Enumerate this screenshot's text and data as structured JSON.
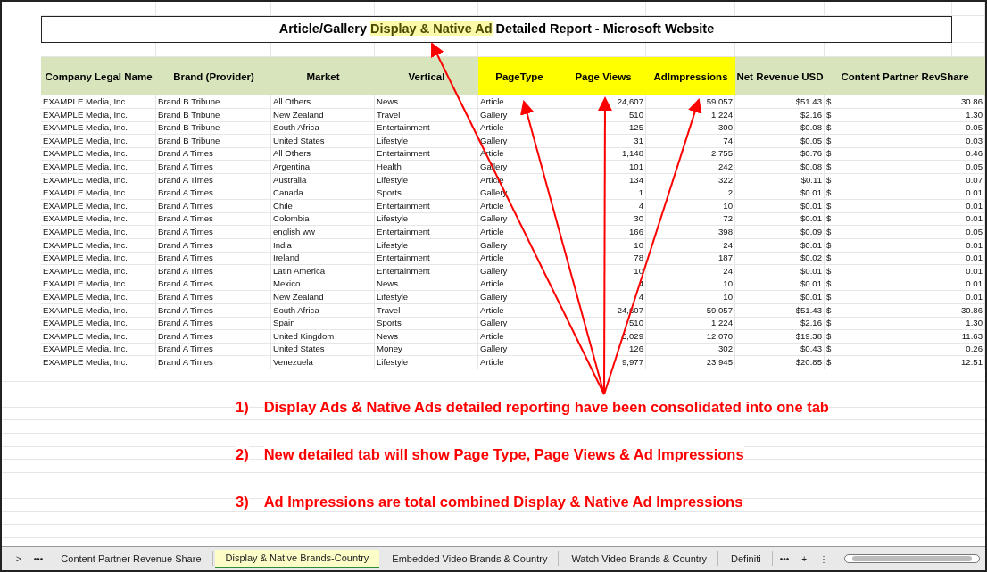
{
  "title": {
    "before": "Article/Gallery ",
    "highlight": "Display & Native Ad",
    "after": " Detailed Report - Microsoft Website"
  },
  "columns": [
    {
      "label": "Company Legal Name",
      "highlighted": false
    },
    {
      "label": "Brand (Provider)",
      "highlighted": false
    },
    {
      "label": "Market",
      "highlighted": false
    },
    {
      "label": "Vertical",
      "highlighted": false
    },
    {
      "label": "PageType",
      "highlighted": true
    },
    {
      "label": "Page Views",
      "highlighted": true
    },
    {
      "label": "AdImpressions",
      "highlighted": true
    },
    {
      "label": "Net Revenue USD",
      "highlighted": false
    },
    {
      "label": "Content Partner RevShare",
      "highlighted": false
    }
  ],
  "rows": [
    [
      "EXAMPLE Media, Inc.",
      "Brand B Tribune",
      "All Others",
      "News",
      "Article",
      "24,607",
      "59,057",
      "$51.43",
      "$",
      "30.86"
    ],
    [
      "EXAMPLE Media, Inc.",
      "Brand B Tribune",
      "New Zealand",
      "Travel",
      "Gallery",
      "510",
      "1,224",
      "$2.16",
      "$",
      "1.30"
    ],
    [
      "EXAMPLE Media, Inc.",
      "Brand B Tribune",
      "South Africa",
      "Entertainment",
      "Article",
      "125",
      "300",
      "$0.08",
      "$",
      "0.05"
    ],
    [
      "EXAMPLE Media, Inc.",
      "Brand B Tribune",
      "United States",
      "Lifestyle",
      "Gallery",
      "31",
      "74",
      "$0.05",
      "$",
      "0.03"
    ],
    [
      "EXAMPLE Media, Inc.",
      "Brand A Times",
      "All Others",
      "Entertainment",
      "Article",
      "1,148",
      "2,755",
      "$0.76",
      "$",
      "0.46"
    ],
    [
      "EXAMPLE Media, Inc.",
      "Brand A Times",
      "Argentina",
      "Health",
      "Gallery",
      "101",
      "242",
      "$0.08",
      "$",
      "0.05"
    ],
    [
      "EXAMPLE Media, Inc.",
      "Brand A Times",
      "Australia",
      "Lifestyle",
      "Article",
      "134",
      "322",
      "$0.11",
      "$",
      "0.07"
    ],
    [
      "EXAMPLE Media, Inc.",
      "Brand A Times",
      "Canada",
      "Sports",
      "Gallery",
      "1",
      "2",
      "$0.01",
      "$",
      "0.01"
    ],
    [
      "EXAMPLE Media, Inc.",
      "Brand A Times",
      "Chile",
      "Entertainment",
      "Article",
      "4",
      "10",
      "$0.01",
      "$",
      "0.01"
    ],
    [
      "EXAMPLE Media, Inc.",
      "Brand A Times",
      "Colombia",
      "Lifestyle",
      "Gallery",
      "30",
      "72",
      "$0.01",
      "$",
      "0.01"
    ],
    [
      "EXAMPLE Media, Inc.",
      "Brand A Times",
      "english ww",
      "Entertainment",
      "Article",
      "166",
      "398",
      "$0.09",
      "$",
      "0.05"
    ],
    [
      "EXAMPLE Media, Inc.",
      "Brand A Times",
      "India",
      "Lifestyle",
      "Gallery",
      "10",
      "24",
      "$0.01",
      "$",
      "0.01"
    ],
    [
      "EXAMPLE Media, Inc.",
      "Brand A Times",
      "Ireland",
      "Entertainment",
      "Article",
      "78",
      "187",
      "$0.02",
      "$",
      "0.01"
    ],
    [
      "EXAMPLE Media, Inc.",
      "Brand A Times",
      "Latin America",
      "Entertainment",
      "Gallery",
      "10",
      "24",
      "$0.01",
      "$",
      "0.01"
    ],
    [
      "EXAMPLE Media, Inc.",
      "Brand A Times",
      "Mexico",
      "News",
      "Article",
      "4",
      "10",
      "$0.01",
      "$",
      "0.01"
    ],
    [
      "EXAMPLE Media, Inc.",
      "Brand A Times",
      "New Zealand",
      "Lifestyle",
      "Gallery",
      "4",
      "10",
      "$0.01",
      "$",
      "0.01"
    ],
    [
      "EXAMPLE Media, Inc.",
      "Brand A Times",
      "South Africa",
      "Travel",
      "Article",
      "24,607",
      "59,057",
      "$51.43",
      "$",
      "30.86"
    ],
    [
      "EXAMPLE Media, Inc.",
      "Brand A Times",
      "Spain",
      "Sports",
      "Gallery",
      "510",
      "1,224",
      "$2.16",
      "$",
      "1.30"
    ],
    [
      "EXAMPLE Media, Inc.",
      "Brand A Times",
      "United Kingdom",
      "News",
      "Article",
      "5,029",
      "12,070",
      "$19.38",
      "$",
      "11.63"
    ],
    [
      "EXAMPLE Media, Inc.",
      "Brand A Times",
      "United States",
      "Money",
      "Gallery",
      "126",
      "302",
      "$0.43",
      "$",
      "0.26"
    ],
    [
      "EXAMPLE Media, Inc.",
      "Brand A Times",
      "Venezuela",
      "Lifestyle",
      "Article",
      "9,977",
      "23,945",
      "$20.85",
      "$",
      "12.51"
    ]
  ],
  "notes": [
    {
      "number": "1)",
      "text": "Display Ads & Native Ads detailed reporting have been consolidated into one tab"
    },
    {
      "number": "2)",
      "text": "New detailed tab will show Page Type, Page Views & Ad Impressions"
    },
    {
      "number": "3)",
      "text": "Ad Impressions are total combined Display & Native Ad Impressions"
    }
  ],
  "tab_bar": {
    "next": ">",
    "more_left": "•••",
    "more_right": "•••",
    "add": "+",
    "options": "⋮",
    "tabs": [
      {
        "label": "Content Partner Revenue Share",
        "selected": false
      },
      {
        "label": "Display & Native Brands-Country",
        "selected": true
      },
      {
        "label": "Embedded Video Brands & Country",
        "selected": false
      },
      {
        "label": "Watch Video Brands & Country",
        "selected": false
      },
      {
        "label": "Definiti",
        "selected": false
      }
    ]
  }
}
